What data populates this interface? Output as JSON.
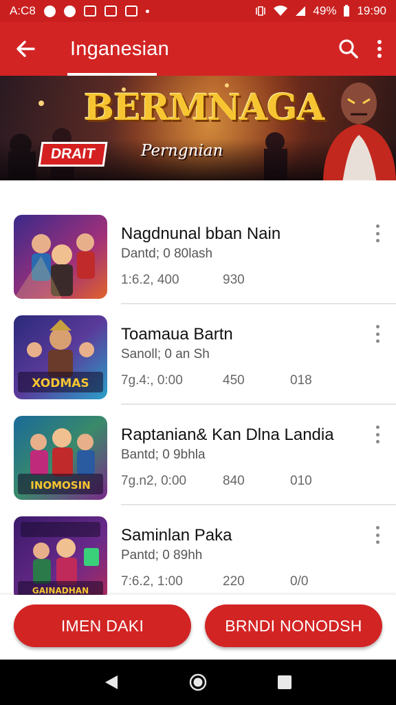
{
  "status_bar": {
    "left_text": "A:C8",
    "battery_percent": "49%",
    "time": "19:90"
  },
  "app_bar": {
    "title": "Inganesian"
  },
  "banner": {
    "title": "BERMNAGA",
    "subtitle": "Perngnian",
    "badge": "DRAIT"
  },
  "list": [
    {
      "title": "Nagdnunal bban Nain",
      "subtitle": "Dantd; 0 80lash",
      "stats": [
        "1:6.2, 400",
        "930",
        ""
      ],
      "art": {
        "bg1": "#3a2a8a",
        "bg2": "#e0632a",
        "label": ""
      }
    },
    {
      "title": "Toamaua Bartn",
      "subtitle": "Sanoll; 0 an Sh",
      "stats": [
        "7g.4:, 0:00",
        "450",
        "018"
      ],
      "art": {
        "bg1": "#2a2a7a",
        "bg2": "#2aa0c8",
        "label": "XODMAS"
      }
    },
    {
      "title": "Raptanian& Kan Dlna Landia",
      "subtitle": "Bantd; 0 9bhla",
      "stats": [
        "7g.n2, 0:00",
        "840",
        "010"
      ],
      "art": {
        "bg1": "#1a6a9a",
        "bg2": "#7a2a8a",
        "label": "INOMOSIN"
      }
    },
    {
      "title": "Saminlan Paka",
      "subtitle": "Pantd; 0 89hh",
      "stats": [
        "7:6.2, 1:00",
        "220",
        "0/0"
      ],
      "art": {
        "bg1": "#3a1a6a",
        "bg2": "#b02a5a",
        "label": "GAINADHAN"
      }
    }
  ],
  "buttons": {
    "left": "IMEN DAKI",
    "right": "BRNDI NONODSH"
  },
  "colors": {
    "primary": "#d32424",
    "banner_title": "#f7c531"
  },
  "icons": {
    "back": "arrow-left-icon",
    "search": "search-icon",
    "menu": "more-vert-icon"
  }
}
